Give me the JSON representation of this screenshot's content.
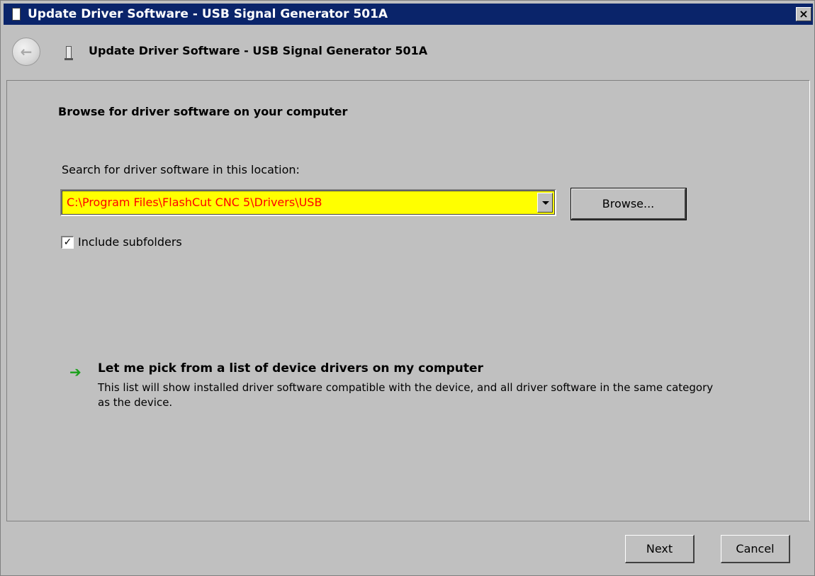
{
  "window": {
    "title": "Update Driver Software - USB Signal Generator 501A",
    "close_glyph": "×"
  },
  "nav": {
    "back_glyph": "←",
    "title": "Update Driver Software - USB Signal Generator 501A"
  },
  "content": {
    "heading": "Browse for driver software on your computer",
    "search_label": "Search for driver software in this location:",
    "path_value": "C:\\Program Files\\FlashCut CNC 5\\Drivers\\USB",
    "path_text_color": "#ff0000",
    "path_bg_color": "#ffff00",
    "browse_label": "Browse...",
    "include_subfolders_label": "Include subfolders",
    "include_subfolders_checked": true,
    "pick_title": "Let me pick from a list of device drivers on my computer",
    "pick_description": "This list will show installed driver software compatible with the device, and all driver software in the same category as the device."
  },
  "footer": {
    "next_label": "Next",
    "cancel_label": "Cancel"
  },
  "icons": {
    "title_icon": "device-icon",
    "back_icon": "back-arrow-icon",
    "pick_icon": "green-arrow-icon"
  }
}
